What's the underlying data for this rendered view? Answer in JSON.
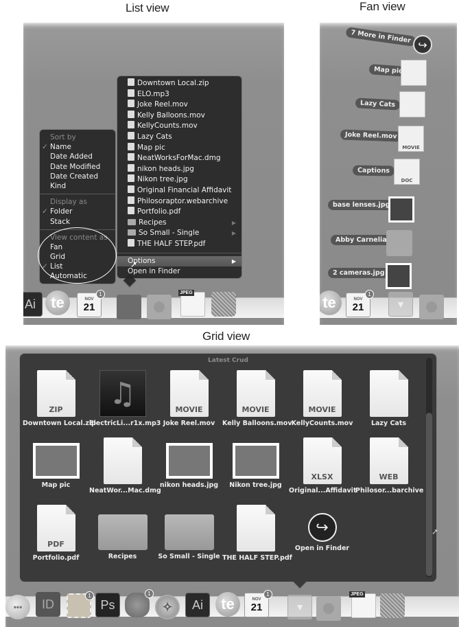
{
  "captions": {
    "list_view": "List view",
    "fan_view": "Fan view",
    "grid_view": "Grid view"
  },
  "list_view": {
    "files": [
      {
        "name": "Downtown Local.zip",
        "icon": "zip-file-icon",
        "submenu": false
      },
      {
        "name": "ELO.mp3",
        "icon": "music-file-icon",
        "submenu": false
      },
      {
        "name": "Joke Reel.mov",
        "icon": "movie-alias-icon",
        "submenu": false
      },
      {
        "name": "Kelly Balloons.mov",
        "icon": "movie-file-icon",
        "submenu": false
      },
      {
        "name": "KellyCounts.mov",
        "icon": "movie-file-icon",
        "submenu": false
      },
      {
        "name": "Lazy Cats",
        "icon": "document-icon",
        "submenu": false
      },
      {
        "name": "Map pic",
        "icon": "image-file-icon",
        "submenu": false
      },
      {
        "name": "NeatWorksForMac.dmg",
        "icon": "disk-image-icon",
        "submenu": false
      },
      {
        "name": "nikon heads.jpg",
        "icon": "photo-icon",
        "submenu": false
      },
      {
        "name": "Nikon tree.jpg",
        "icon": "photo-icon",
        "submenu": false
      },
      {
        "name": "Original Financial Affidavit",
        "icon": "document-icon",
        "submenu": false
      },
      {
        "name": "Philosoraptor.webarchive",
        "icon": "webarchive-icon",
        "submenu": false
      },
      {
        "name": "Portfolio.pdf",
        "icon": "pdf-icon",
        "submenu": false
      },
      {
        "name": "Recipes",
        "icon": "folder-icon",
        "submenu": true
      },
      {
        "name": "So Small - Single",
        "icon": "folder-icon",
        "submenu": true
      },
      {
        "name": "THE HALF STEP.pdf",
        "icon": "pdf-icon",
        "submenu": false
      }
    ],
    "options_label": "Options",
    "open_in_finder_label": "Open in Finder",
    "options_menu": {
      "sort_by_header": "Sort by",
      "sort_by": [
        {
          "label": "Name",
          "checked": true
        },
        {
          "label": "Date Added",
          "checked": false
        },
        {
          "label": "Date Modified",
          "checked": false
        },
        {
          "label": "Date Created",
          "checked": false
        },
        {
          "label": "Kind",
          "checked": false
        }
      ],
      "display_as_header": "Display as",
      "display_as": [
        {
          "label": "Folder",
          "checked": true
        },
        {
          "label": "Stack",
          "checked": false
        }
      ],
      "view_content_header": "View content as",
      "view_content": [
        {
          "label": "Fan",
          "checked": false
        },
        {
          "label": "Grid",
          "checked": false
        },
        {
          "label": "List",
          "checked": true
        },
        {
          "label": "Automatic",
          "checked": false
        }
      ]
    },
    "check_mark": "✓"
  },
  "fan_view": {
    "items": [
      {
        "label": "7 More in Finder",
        "thumb": "finder-arrow-icon"
      },
      {
        "label": "Map pic",
        "thumb": "map-thumbnail"
      },
      {
        "label": "Lazy Cats",
        "thumb": "blank-document-icon"
      },
      {
        "label": "Joke Reel.mov",
        "thumb": "movie-file-icon",
        "ext": "MOVIE"
      },
      {
        "label": "Captions",
        "thumb": "doc-file-icon",
        "ext": "DOC"
      },
      {
        "label": "base lenses.jpg",
        "thumb": "photo-thumbnail"
      },
      {
        "label": "Abby Carnelia",
        "thumb": "folder-icon"
      },
      {
        "label": "2 cameras.jpg",
        "thumb": "photo-thumbnail"
      }
    ]
  },
  "grid_view": {
    "title": "Latest Crud",
    "items": [
      {
        "name": "Downtown Local.zip",
        "kind": "file",
        "ext": "ZIP"
      },
      {
        "name": "ElectricLi...r1x.mp3",
        "kind": "music",
        "ext": ""
      },
      {
        "name": "Joke Reel.mov",
        "kind": "file",
        "ext": "MOVIE"
      },
      {
        "name": "Kelly Balloons.mov",
        "kind": "file",
        "ext": "MOVIE"
      },
      {
        "name": "KellyCounts.mov",
        "kind": "file",
        "ext": "MOVIE"
      },
      {
        "name": "Lazy Cats",
        "kind": "file",
        "ext": ""
      },
      {
        "name": "Map pic",
        "kind": "photo",
        "ext": ""
      },
      {
        "name": "NeatWor...Mac.dmg",
        "kind": "file",
        "ext": ""
      },
      {
        "name": "nikon heads.jpg",
        "kind": "photo",
        "ext": ""
      },
      {
        "name": "Nikon tree.jpg",
        "kind": "photo",
        "ext": ""
      },
      {
        "name": "Original...Affidavit",
        "kind": "file",
        "ext": "XLSX"
      },
      {
        "name": "Philosor...barchive",
        "kind": "file",
        "ext": "WEB"
      },
      {
        "name": "Portfolio.pdf",
        "kind": "file",
        "ext": "PDF"
      },
      {
        "name": "Recipes",
        "kind": "folder",
        "ext": ""
      },
      {
        "name": "So Small - Single",
        "kind": "folder",
        "ext": ""
      },
      {
        "name": "THE HALF STEP.pdf",
        "kind": "file",
        "ext": ""
      },
      {
        "name": "Open in Finder",
        "kind": "finder",
        "ext": ""
      }
    ],
    "scroll_position": 0.25
  },
  "dock": {
    "calendar_month": "NOV",
    "calendar_day": "21",
    "calendar_badge": "1",
    "mail_badge": "1",
    "brain_badge": "1",
    "jpeg_tag": "JPEG",
    "ai_label": "Ai",
    "ps_label": "Ps",
    "id_label": "ID",
    "te_label": "te"
  }
}
